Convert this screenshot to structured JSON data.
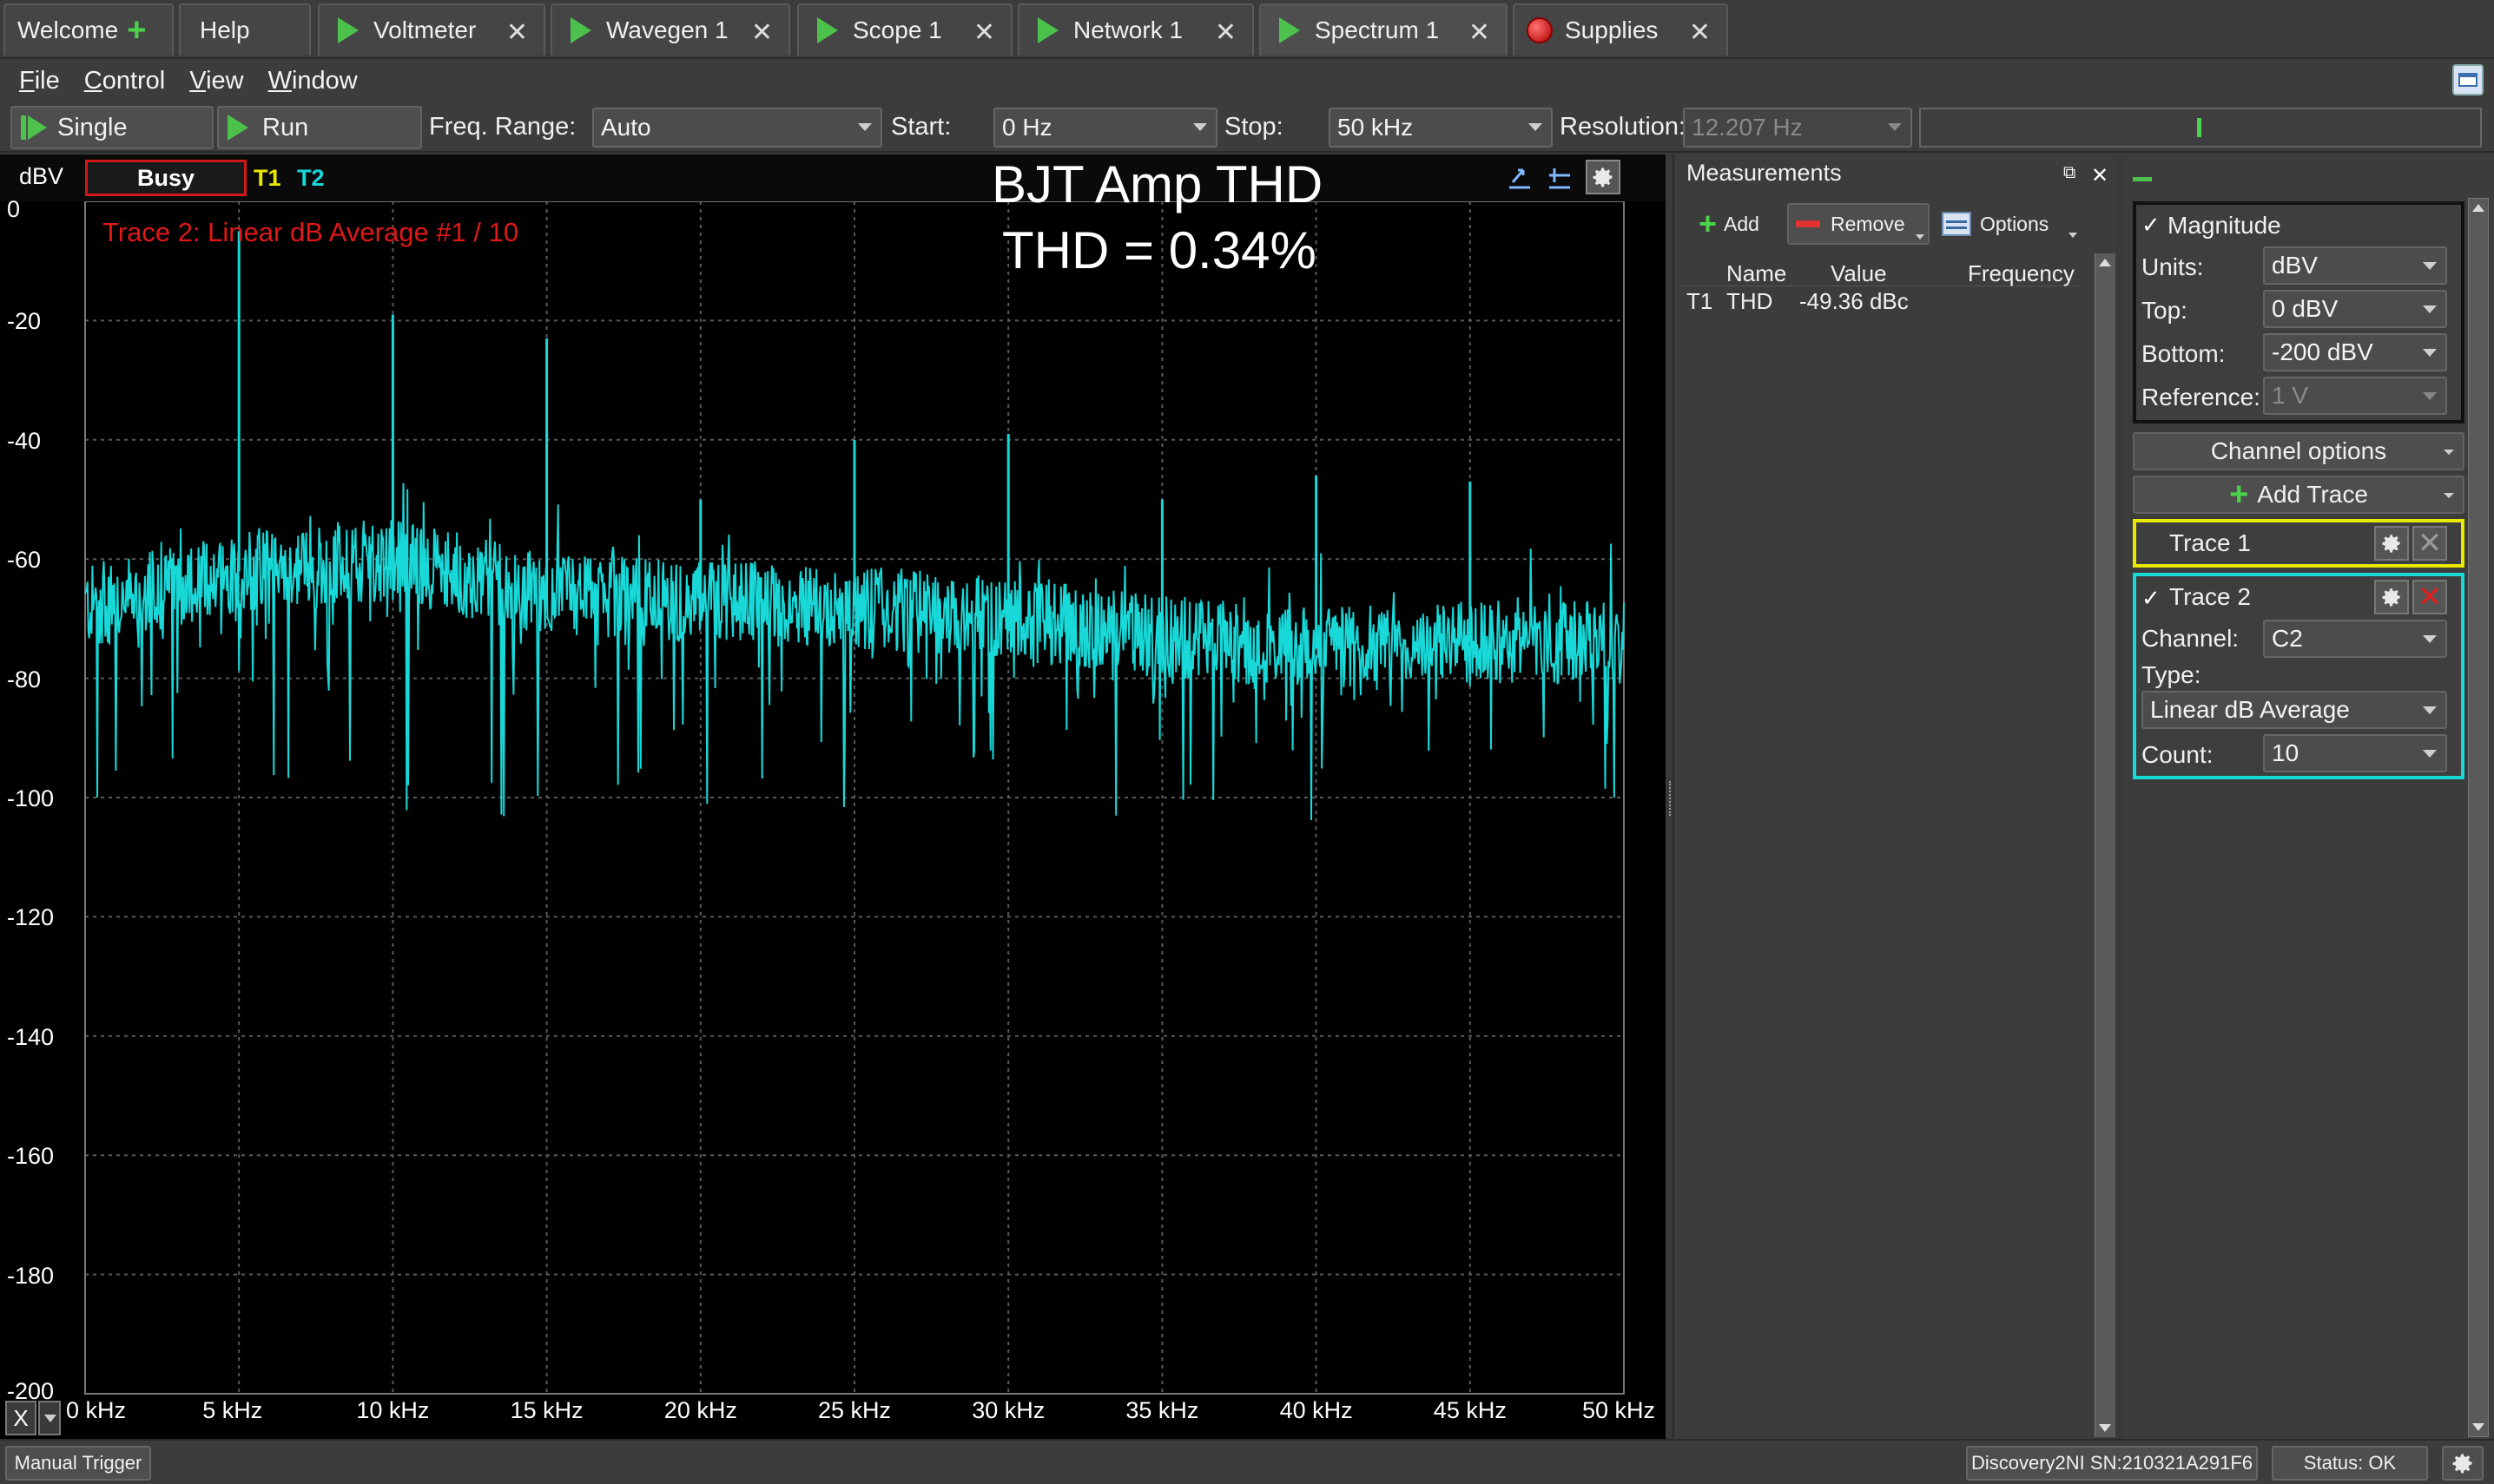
{
  "tabs": [
    {
      "label": "Welcome",
      "icon": "plus-icon"
    },
    {
      "label": "Help",
      "icon": ""
    },
    {
      "label": "Voltmeter",
      "icon": "play-icon"
    },
    {
      "label": "Wavegen 1",
      "icon": "play-icon"
    },
    {
      "label": "Scope 1",
      "icon": "play-icon"
    },
    {
      "label": "Network 1",
      "icon": "play-icon"
    },
    {
      "label": "Spectrum 1",
      "icon": "play-icon",
      "active": true
    },
    {
      "label": "Supplies",
      "icon": "record-icon"
    }
  ],
  "menu": [
    "File",
    "Control",
    "View",
    "Window"
  ],
  "toolbar": {
    "single_label": "Single",
    "run_label": "Run",
    "freq_range_label": "Freq. Range:",
    "freq_range_value": "Auto",
    "start_label": "Start:",
    "start_value": "0 Hz",
    "stop_label": "Stop:",
    "stop_value": "50 kHz",
    "resolution_label": "Resolution:",
    "resolution_value": "12.207 Hz"
  },
  "plot": {
    "unit": "dBV",
    "status": "Busy",
    "trace_tags": [
      "T1",
      "T2"
    ],
    "title_line1": "BJT Amp THD",
    "title_line2": "THD = 0.34%",
    "trace_label": "Trace 2: Linear dB Average #1 / 10",
    "x_button": "X"
  },
  "colors": {
    "trace2": "#18d8d8",
    "trace1": "#e8e800",
    "busy_border": "#d01818",
    "grid": "#5a5a5a",
    "background": "#000000"
  },
  "chart_data": {
    "type": "line",
    "xlabel": "",
    "ylabel": "dBV",
    "xlim": [
      0,
      50000
    ],
    "ylim": [
      -200,
      0
    ],
    "x_ticks": [
      "0 kHz",
      "5 kHz",
      "10 kHz",
      "15 kHz",
      "20 kHz",
      "25 kHz",
      "30 kHz",
      "35 kHz",
      "40 kHz",
      "45 kHz",
      "50 kHz"
    ],
    "y_ticks": [
      "0",
      "-20",
      "-40",
      "-60",
      "-80",
      "-100",
      "-120",
      "-140",
      "-160",
      "-180",
      "-200"
    ],
    "grid": true,
    "series": [
      {
        "name": "Trace 2",
        "harmonics_hz": [
          5000,
          10000,
          15000,
          20000,
          25000,
          30000,
          35000,
          40000,
          45000
        ],
        "harmonics_dbv": [
          -5,
          -19,
          -23,
          -50,
          -40,
          -39,
          -50,
          -46,
          -47
        ],
        "noise_floor_dbv": [
          [
            0,
            -68
          ],
          [
            5000,
            -62
          ],
          [
            10000,
            -60
          ],
          [
            15000,
            -66
          ],
          [
            20000,
            -67
          ],
          [
            25000,
            -68
          ],
          [
            30000,
            -70
          ],
          [
            35000,
            -73
          ],
          [
            40000,
            -75
          ],
          [
            45000,
            -74
          ],
          [
            50000,
            -74
          ]
        ],
        "noise_min_dbv": -104
      }
    ]
  },
  "measurements": {
    "title": "Measurements",
    "add_label": "Add",
    "remove_label": "Remove",
    "options_label": "Options",
    "columns": [
      "Name",
      "Value",
      "Frequency"
    ],
    "rows": [
      {
        "trace": "T1",
        "name": "THD",
        "value": "-49.36 dBc",
        "frequency": ""
      }
    ]
  },
  "settings": {
    "magnitude_label": "Magnitude",
    "units_label": "Units:",
    "units_value": "dBV",
    "top_label": "Top:",
    "top_value": "0 dBV",
    "bottom_label": "Bottom:",
    "bottom_value": "-200 dBV",
    "reference_label": "Reference:",
    "reference_value": "1 V",
    "channel_options_label": "Channel options",
    "add_trace_label": "Add Trace",
    "trace1_label": "Trace 1",
    "trace2_label": "Trace 2",
    "channel_label": "Channel:",
    "channel_value": "C2",
    "type_label": "Type:",
    "type_value": "Linear dB Average",
    "count_label": "Count:",
    "count_value": "10"
  },
  "status": {
    "manual_trigger": "Manual Trigger",
    "device": "Discovery2NI SN:210321A291F6",
    "status_text": "Status: OK"
  }
}
